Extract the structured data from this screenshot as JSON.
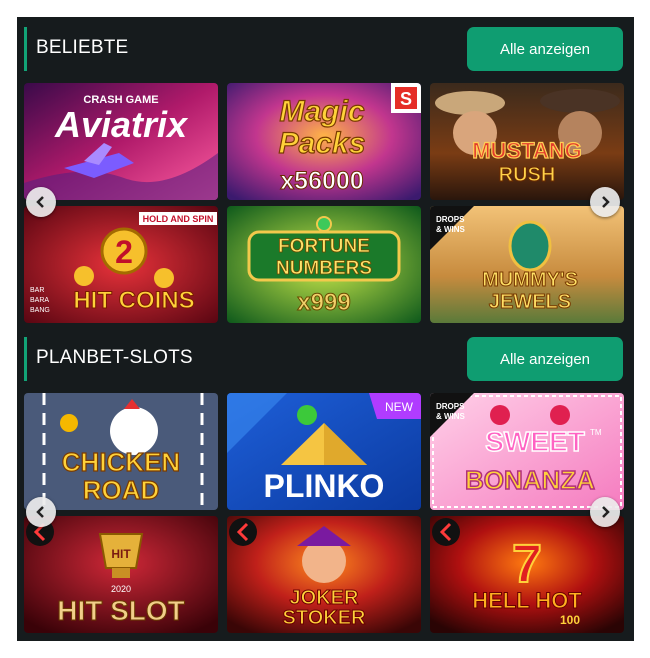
{
  "sections": [
    {
      "title": "BELIEBTE",
      "button_label": "Alle anzeigen",
      "tiles": [
        {
          "name": "Aviatrix",
          "top_text": "CRASH GAME",
          "main_text": "Aviatrix"
        },
        {
          "name": "Magic Packs",
          "line1": "Magic",
          "line2": "Packs",
          "multiplier": "x56000",
          "badge": "S"
        },
        {
          "name": "Mustang Rush",
          "line1": "MUSTANG",
          "line2": "RUSH"
        },
        {
          "name": "Hit Coins",
          "label": "HOLD AND SPIN",
          "number": "2",
          "main_text": "HIT COINS",
          "side_text": [
            "BAR",
            "BARA",
            "BANG"
          ]
        },
        {
          "name": "Fortune Numbers",
          "line1": "FORTUNE",
          "line2": "NUMBERS",
          "multiplier": "x999"
        },
        {
          "name": "Mummy's Jewels",
          "corner_badge": [
            "DROPS",
            "& WINS"
          ],
          "line1": "MUMMY'S",
          "line2": "JEWELS"
        }
      ]
    },
    {
      "title": "PLANBET-SLOTS",
      "button_label": "Alle anzeigen",
      "tiles": [
        {
          "name": "Chicken Road",
          "line1": "CHICKEN",
          "line2": "ROAD"
        },
        {
          "name": "Plinko",
          "main_text": "PLINKO",
          "badge": "NEW"
        },
        {
          "name": "Sweet Bonanza",
          "corner_badge": [
            "DROPS",
            "& WINS"
          ],
          "line1": "SWEET",
          "line2": "BONANZA",
          "tm": "TM"
        },
        {
          "name": "Hit Slot",
          "year": "2020",
          "main_text": "HIT SLOT",
          "top_text": "HIT"
        },
        {
          "name": "Joker Stoker",
          "line1": "JOKER",
          "line2": "STOKER"
        },
        {
          "name": "Hell Hot 100",
          "line1": "HELL HOT",
          "line2": "100",
          "number": "7"
        }
      ]
    }
  ],
  "colors": {
    "panel_bg": "#161b1d",
    "accent": "#12a377",
    "button_bg": "#0f9d71",
    "text": "#ffffff",
    "arrow_bg": "#ebebeb"
  },
  "icons": {
    "prev": "chevron-left-icon",
    "next": "chevron-right-icon",
    "provider": "provider-logo-icon"
  }
}
